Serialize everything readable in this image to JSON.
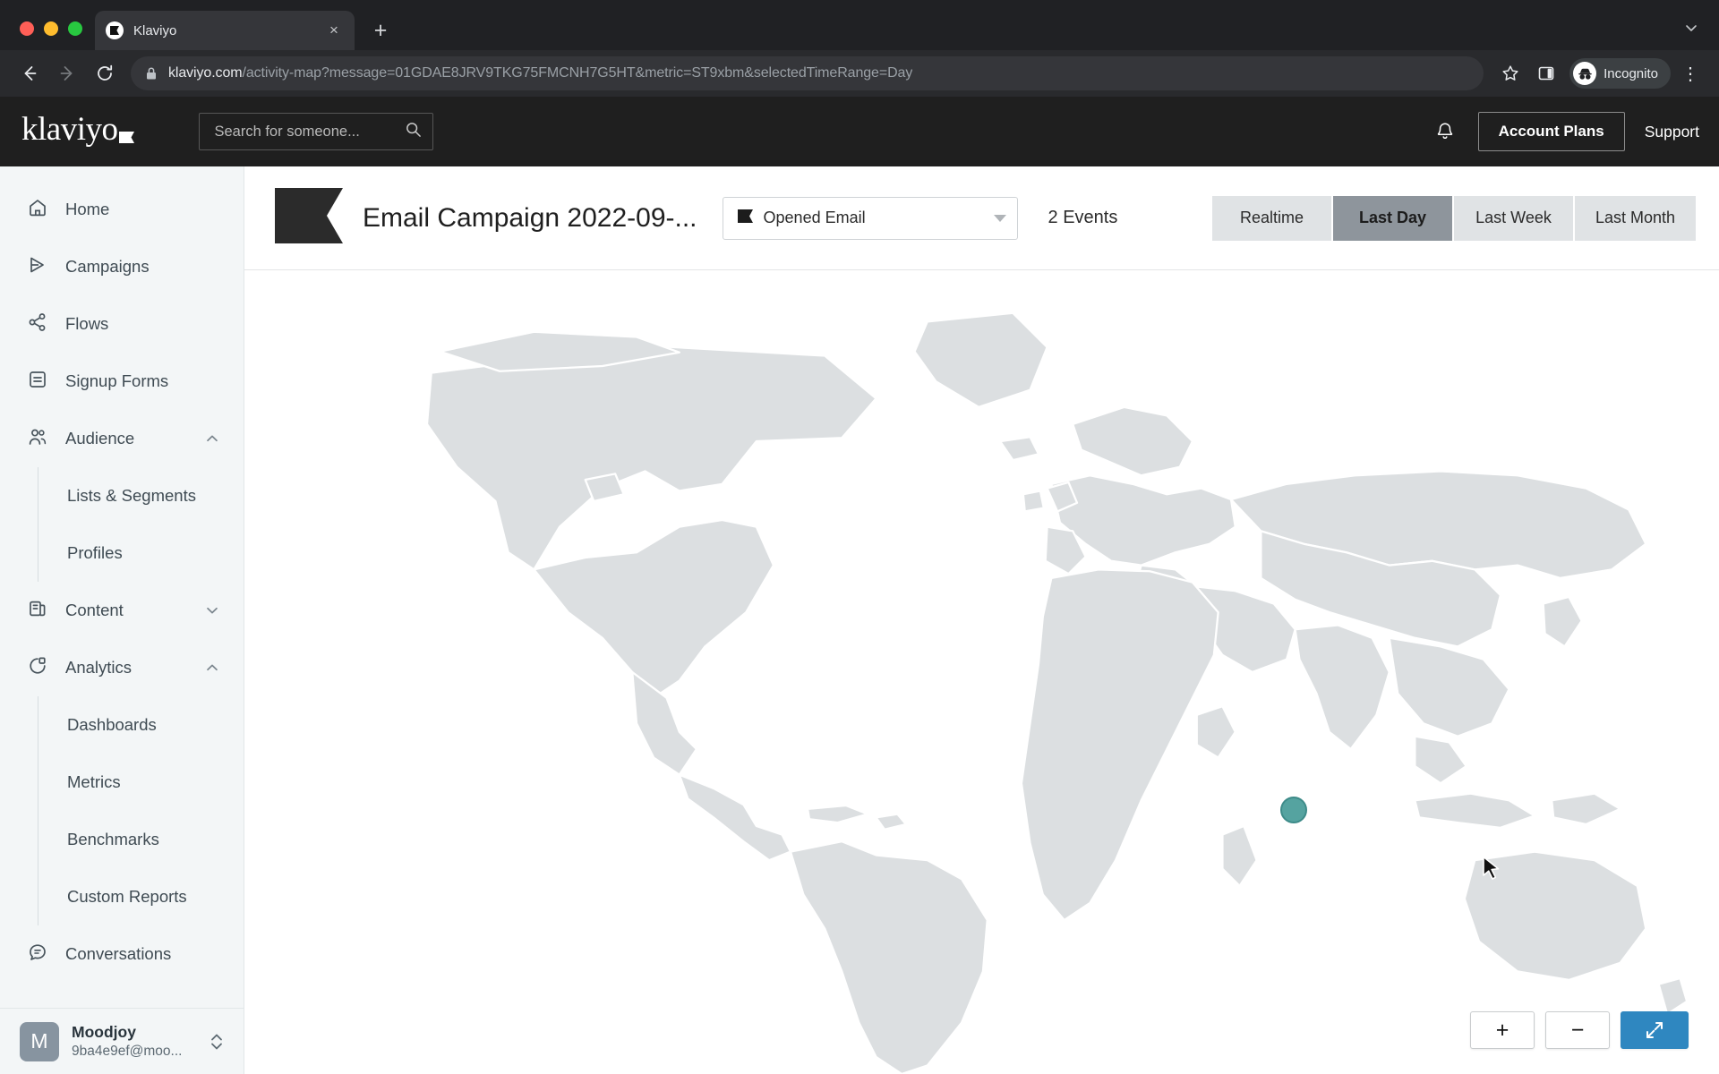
{
  "browser": {
    "tab": {
      "title": "Klaviyo",
      "favicon": "klaviyo-flag-icon",
      "close_label": "×"
    },
    "new_tab_label": "+",
    "tab_list_label": "⌄",
    "back_label": "back-icon",
    "forward_label": "forward-icon",
    "reload_label": "reload-icon",
    "url_secure_prefix": "klaviyo.com",
    "url_rest": "/activity-map?message=01GDAE8JRV9TKG75FMCNH7G5HT&metric=ST9xbm&selectedTimeRange=Day",
    "bookmark_label": "bookmark-star-icon",
    "sidepanel_label": "side-panel-icon",
    "profile_label": "Incognito",
    "menu_label": "⋮"
  },
  "header": {
    "logo_text": "klaviyo",
    "search_placeholder": "Search for someone...",
    "search_value": "",
    "notifications_label": "bell-icon",
    "account_plans_label": "Account Plans",
    "support_label": "Support"
  },
  "sidebar": {
    "items": [
      {
        "label": "Home",
        "icon": "home-icon",
        "expandable": false
      },
      {
        "label": "Campaigns",
        "icon": "campaigns-icon",
        "expandable": false
      },
      {
        "label": "Flows",
        "icon": "flows-icon",
        "expandable": false
      },
      {
        "label": "Signup Forms",
        "icon": "signup-forms-icon",
        "expandable": false
      },
      {
        "label": "Audience",
        "icon": "audience-icon",
        "expandable": true,
        "expanded": true
      },
      {
        "label": "Content",
        "icon": "content-icon",
        "expandable": true,
        "expanded": false
      },
      {
        "label": "Analytics",
        "icon": "analytics-icon",
        "expandable": true,
        "expanded": true
      },
      {
        "label": "Conversations",
        "icon": "conversations-icon",
        "expandable": false
      }
    ],
    "audience_children": [
      {
        "label": "Lists & Segments"
      },
      {
        "label": "Profiles"
      }
    ],
    "analytics_children": [
      {
        "label": "Dashboards"
      },
      {
        "label": "Metrics"
      },
      {
        "label": "Benchmarks"
      },
      {
        "label": "Custom Reports"
      }
    ],
    "account": {
      "initial": "M",
      "name": "Moodjoy",
      "email": "9ba4e9ef@moo..."
    }
  },
  "page": {
    "title": "Email Campaign 2022-09-...",
    "title_icon": "campaign-ribbon-icon",
    "metric_select": {
      "value": "Opened Email",
      "swatch_icon": "flag-icon"
    },
    "events_text": "2 Events",
    "range_tabs": [
      {
        "label": "Realtime",
        "active": false
      },
      {
        "label": "Last Day",
        "active": true
      },
      {
        "label": "Last Week",
        "active": false
      },
      {
        "label": "Last Month",
        "active": false
      }
    ]
  },
  "map": {
    "land_color": "#dcdfe1",
    "border_color": "#ffffff",
    "ocean_color": "#ffffff",
    "marker": {
      "fill": "#55a3a0",
      "stroke": "#3d8b89",
      "label": "event-marker"
    },
    "controls": {
      "zoom_in_label": "+",
      "zoom_out_label": "−",
      "fullscreen_label": "expand-icon",
      "fullscreen_color": "#2f87c0"
    }
  }
}
